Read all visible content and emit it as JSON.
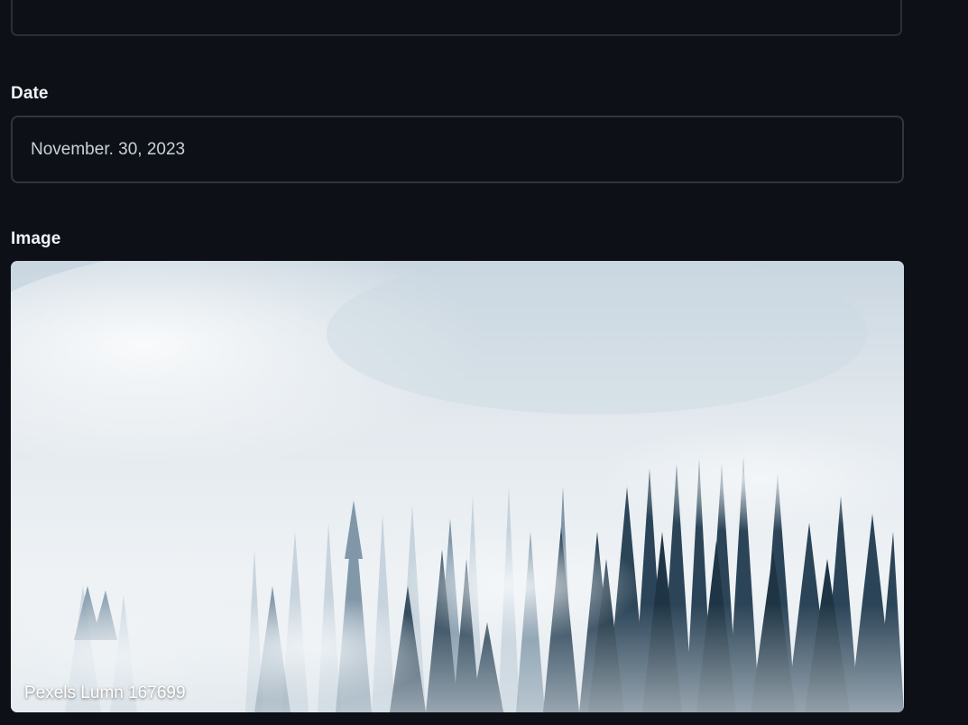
{
  "form": {
    "date": {
      "label": "Date",
      "value": "November. 30, 2023"
    },
    "image": {
      "label": "Image",
      "caption": "Pexels Lumn 167699",
      "subject": "misty-forest-photo"
    }
  },
  "colors": {
    "background": "#0d1117",
    "border": "#30363d",
    "label": "#f0f3f6",
    "value_text": "#c9d1d9"
  }
}
